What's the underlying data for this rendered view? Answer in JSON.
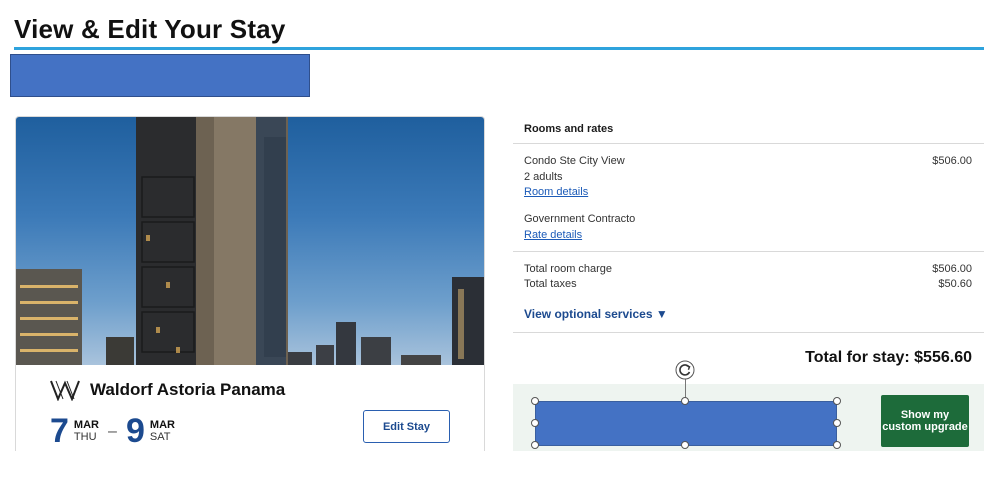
{
  "page": {
    "title": "View & Edit Your Stay"
  },
  "hotel": {
    "name": "Waldorf Astoria Panama",
    "checkin": {
      "day": "7",
      "month": "MAR",
      "weekday": "THU"
    },
    "separator": "–",
    "checkout": {
      "day": "9",
      "month": "MAR",
      "weekday": "SAT"
    },
    "edit_label": "Edit Stay"
  },
  "rates": {
    "header": "Rooms and rates",
    "room_name": "Condo Ste City View",
    "room_price": "$506.00",
    "guests": "2 adults",
    "room_details_link": "Room details",
    "rate_name": "Government Contracto",
    "rate_details_link": "Rate details",
    "total_room_label": "Total room charge",
    "total_room_value": "$506.00",
    "total_taxes_label": "Total taxes",
    "total_taxes_value": "$50.60",
    "optional_services": "View optional services ▼",
    "total_stay": "Total for stay: $556.60",
    "upgrade_label": "Show my custom upgrade"
  },
  "colors": {
    "accent_rule": "#2ea3dd",
    "redaction": "#4472c4",
    "brand_blue": "#1c4a8f",
    "upgrade_green": "#1d6b3a"
  },
  "icons": [
    "waldorf-astoria-logo-icon",
    "rotate-handle-icon"
  ]
}
